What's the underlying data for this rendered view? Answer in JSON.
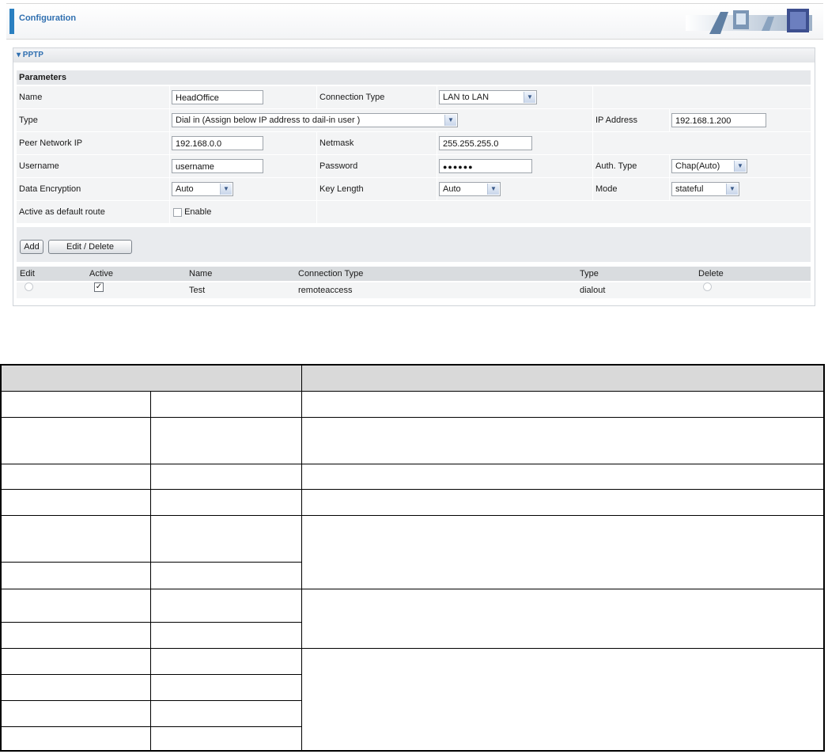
{
  "header": {
    "title": "Configuration"
  },
  "section": {
    "title": "▾ PPTP",
    "params_title": "Parameters"
  },
  "form": {
    "name_label": "Name",
    "name_value": "HeadOffice",
    "connection_type_label": "Connection Type",
    "connection_type_value": "LAN to LAN",
    "type_label": "Type",
    "type_value": "Dial in (Assign below IP address to dail-in user )",
    "ip_address_label": "IP Address",
    "ip_address_value": "192.168.1.200",
    "peer_network_ip_label": "Peer Network IP",
    "peer_network_ip_value": "192.168.0.0",
    "netmask_label": "Netmask",
    "netmask_value": "255.255.255.0",
    "username_label": "Username",
    "username_value": "username",
    "password_label": "Password",
    "password_value": "●●●●●●",
    "auth_type_label": "Auth. Type",
    "auth_type_value": "Chap(Auto)",
    "data_encryption_label": "Data Encryption",
    "data_encryption_value": "Auto",
    "key_length_label": "Key Length",
    "key_length_value": "Auto",
    "mode_label": "Mode",
    "mode_value": "stateful",
    "default_route_label": "Active as default route",
    "default_route_enable_label": "Enable",
    "default_route_enabled": false
  },
  "buttons": {
    "add_label": "Add",
    "edit_delete_label": "Edit / Delete"
  },
  "list": {
    "columns": [
      "Edit",
      "Active",
      "Name",
      "Connection Type",
      "Type",
      "Delete"
    ],
    "rows": [
      {
        "active": true,
        "name": "Test",
        "connection_type": "remoteaccess",
        "type": "dialout"
      }
    ]
  },
  "colors": {
    "accent": "#2a7fc0",
    "title_text": "#2f6fb0",
    "row_bg": "#f3f4f5",
    "header_bg": "#d9dcdf"
  }
}
